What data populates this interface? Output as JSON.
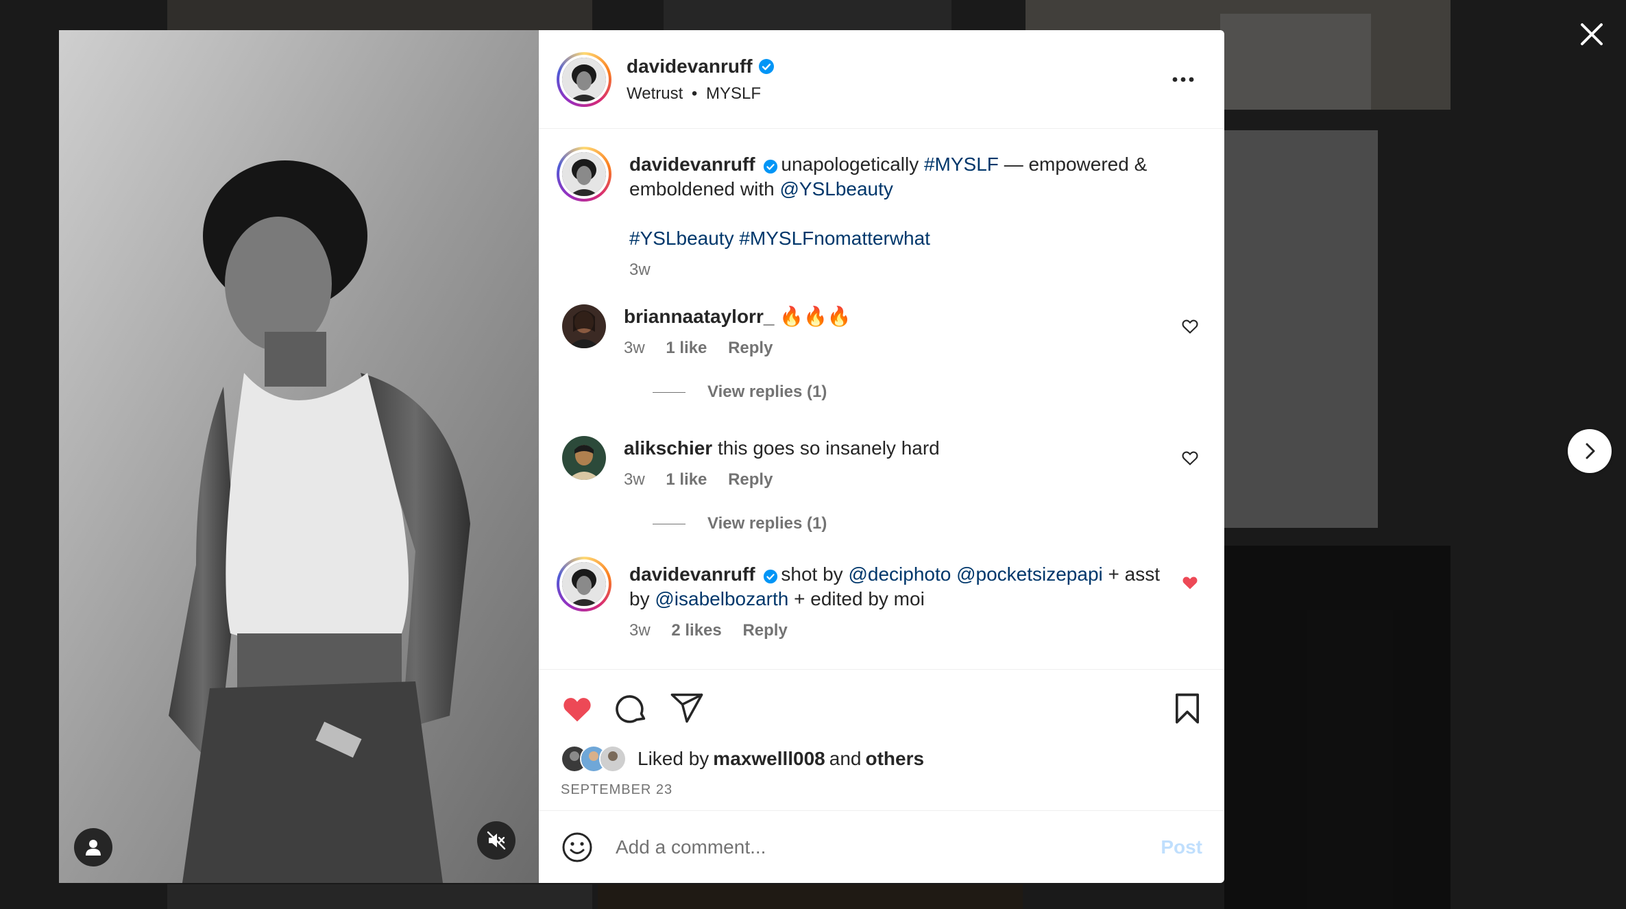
{
  "post": {
    "author": "davidevanruff",
    "location_parts": [
      "Wetrust",
      "MYSLF"
    ],
    "location_separator": "•",
    "more_icon": "more-horizontal-icon"
  },
  "caption": {
    "author": "davidevanruff",
    "text_before": "unapologetically ",
    "hashtag1": "#MYSLF",
    "text_middle": " — empowered & emboldened with ",
    "mention": "@YSLbeauty",
    "hashtags": [
      "#YSLbeauty",
      "#MYSLFnomatterwhat"
    ],
    "time": "3w"
  },
  "comments": [
    {
      "author": "briannaataylorr_",
      "text": "🔥🔥🔥",
      "time": "3w",
      "likes": "1 like",
      "reply": "Reply",
      "liked": false,
      "view_replies": "View replies (1)"
    },
    {
      "author": "alikschier",
      "text": "this goes so insanely hard",
      "time": "3w",
      "likes": "1 like",
      "reply": "Reply",
      "liked": false,
      "view_replies": "View replies (1)"
    },
    {
      "author": "davidevanruff",
      "text_1": "shot by ",
      "mention_1": "@deciphoto",
      "mention_2": "@pocketsizepapi",
      "text_2": " + asst by ",
      "mention_3": "@isabelbozarth",
      "text_3": " + edited by moi",
      "time": "3w",
      "likes": "2 likes",
      "reply": "Reply",
      "liked": true
    }
  ],
  "actions": {
    "like_icon": "heart-filled-icon",
    "comment_icon": "comment-icon",
    "share_icon": "send-icon",
    "save_icon": "bookmark-icon"
  },
  "likes": {
    "prefix": "Liked by ",
    "user": "maxwelll008",
    "middle": " and ",
    "others": "others"
  },
  "date": "SEPTEMBER 23",
  "add_comment": {
    "placeholder": "Add a comment...",
    "post_label": "Post"
  },
  "colors": {
    "like_red": "#ed4956",
    "link_blue": "#00376b",
    "verified_blue": "#0095f6",
    "muted_text": "#737373",
    "post_disabled": "#c0dffd"
  }
}
